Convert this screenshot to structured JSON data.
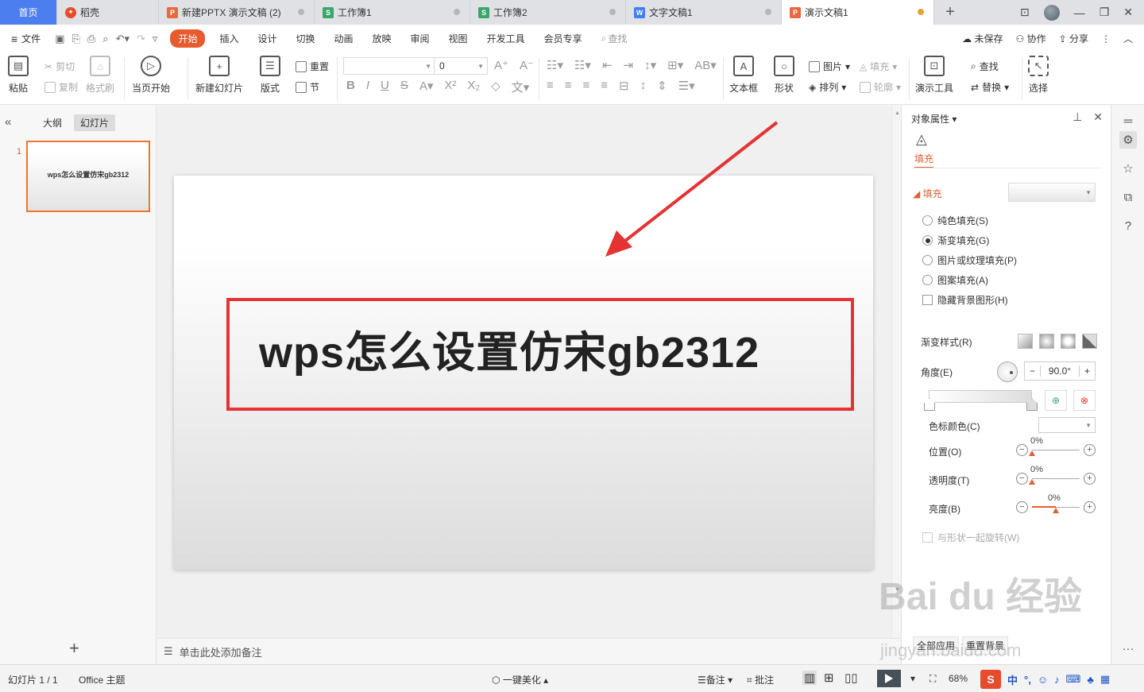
{
  "tabs": [
    {
      "label": "首页",
      "icon": "home",
      "color": "#4d7ef0"
    },
    {
      "label": "稻壳",
      "icon": "docer-icon",
      "color": "#e84a2e"
    },
    {
      "label": "新建PPTX 演示文稿 (2)",
      "icon": "P",
      "color": "#e9683d"
    },
    {
      "label": "工作簿1",
      "icon": "S",
      "color": "#3aa769"
    },
    {
      "label": "工作簿2",
      "icon": "S",
      "color": "#3aa769"
    },
    {
      "label": "文字文稿1",
      "icon": "W",
      "color": "#3f7ff0"
    },
    {
      "label": "演示文稿1",
      "icon": "P",
      "color": "#e9683d"
    }
  ],
  "menubar": {
    "file": "文件",
    "items": [
      "开始",
      "插入",
      "设计",
      "切换",
      "动画",
      "放映",
      "审阅",
      "视图",
      "开发工具",
      "会员专享"
    ],
    "active": "开始",
    "search": "查找",
    "unsaved": "未保存",
    "collab": "协作",
    "share": "分享"
  },
  "ribbon": {
    "paste": "粘贴",
    "cut": "剪切",
    "copy": "复制",
    "format_painter": "格式刷",
    "from_current": "当页开始",
    "new_slide": "新建幻灯片",
    "layout": "版式",
    "reset": "重置",
    "section": "节",
    "font_size": "0",
    "textbox": "文本框",
    "shape": "形状",
    "picture": "图片",
    "arrange": "排列",
    "fill": "填充",
    "outline": "轮廓",
    "present_tools": "演示工具",
    "find": "查找",
    "replace": "替换",
    "select": "选择"
  },
  "left_panel": {
    "tab_outline": "大纲",
    "tab_slides": "幻灯片",
    "slide_number": "1",
    "thumb_title": "wps怎么设置仿宋gb2312"
  },
  "slide": {
    "title": "wps怎么设置仿宋gb2312"
  },
  "notes_placeholder": "单击此处添加备注",
  "prop_panel": {
    "header": "对象属性",
    "tab_fill": "填充",
    "section_fill": "填充",
    "options": [
      {
        "label": "纯色填充(S)",
        "selected": false
      },
      {
        "label": "渐变填充(G)",
        "selected": true
      },
      {
        "label": "图片或纹理填充(P)",
        "selected": false
      },
      {
        "label": "图案填充(A)",
        "selected": false
      }
    ],
    "hide_bg": "隐藏背景图形(H)",
    "gradient_style": "渐变样式(R)",
    "angle_label": "角度(E)",
    "angle_value": "90.0°",
    "stop_color": "色标颜色(C)",
    "position_label": "位置(O)",
    "position_value": "0%",
    "transparency_label": "透明度(T)",
    "transparency_value": "0%",
    "brightness_label": "亮度(B)",
    "brightness_value": "0%",
    "rotate_with_shape": "与形状一起旋转(W)",
    "apply_all": "全部应用",
    "reset_bg": "重置背景"
  },
  "statusbar": {
    "slide_info": "幻灯片 1 / 1",
    "theme": "Office 主题",
    "beautify": "一键美化",
    "notes": "备注",
    "comment": "批注",
    "zoom": "68%",
    "ime_cn": "中"
  },
  "watermark": {
    "text": "Bai du 经验",
    "url": "jingyan.baidu.com"
  },
  "colors": {
    "accent": "#e65c2e",
    "home_tab": "#4d7ef0",
    "red_box": "#e53333"
  }
}
